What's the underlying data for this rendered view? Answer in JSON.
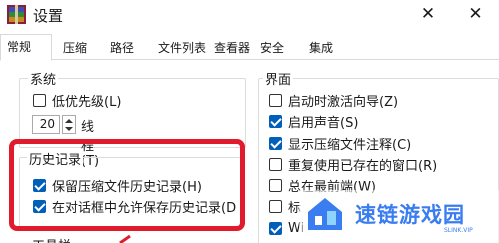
{
  "window": {
    "title": "设置",
    "close_glyph": "✕"
  },
  "tabs": [
    {
      "label": "常规",
      "active": true
    },
    {
      "label": "压缩"
    },
    {
      "label": "路径"
    },
    {
      "label": "文件列表"
    },
    {
      "label": "查看器"
    },
    {
      "label": "安全"
    },
    {
      "label": "集成"
    }
  ],
  "system": {
    "title": "系统",
    "low_priority": {
      "label": "低优先级(L)",
      "checked": false
    },
    "threads": {
      "value": "20",
      "label": "线程(T)"
    }
  },
  "history": {
    "title": "历史记录",
    "items": [
      {
        "label": "保留压缩文件历史记录(H)",
        "checked": true
      },
      {
        "label": "在对话框中允许保存历史记录(D",
        "checked": true
      }
    ]
  },
  "toolbar_section": {
    "title": "工具栏"
  },
  "interface": {
    "title": "界面",
    "items": [
      {
        "label": "启动时激活向导(Z)",
        "checked": false
      },
      {
        "label": "启用声音(S)",
        "checked": true
      },
      {
        "label": "显示压缩文件注释(C)",
        "checked": true
      },
      {
        "label": "重复使用已存在的窗口(R)",
        "checked": false
      },
      {
        "label": "总在最前端(W)",
        "checked": false
      },
      {
        "label": "标",
        "checked": false
      },
      {
        "label": "Wi",
        "checked": true
      }
    ]
  },
  "watermark": {
    "text": "速链游戏园",
    "sub": "SLINK.VIP"
  },
  "colors": {
    "highlight": "#e11b2c",
    "checkbox_on": "#005fb8",
    "watermark": "#3a7df0"
  }
}
